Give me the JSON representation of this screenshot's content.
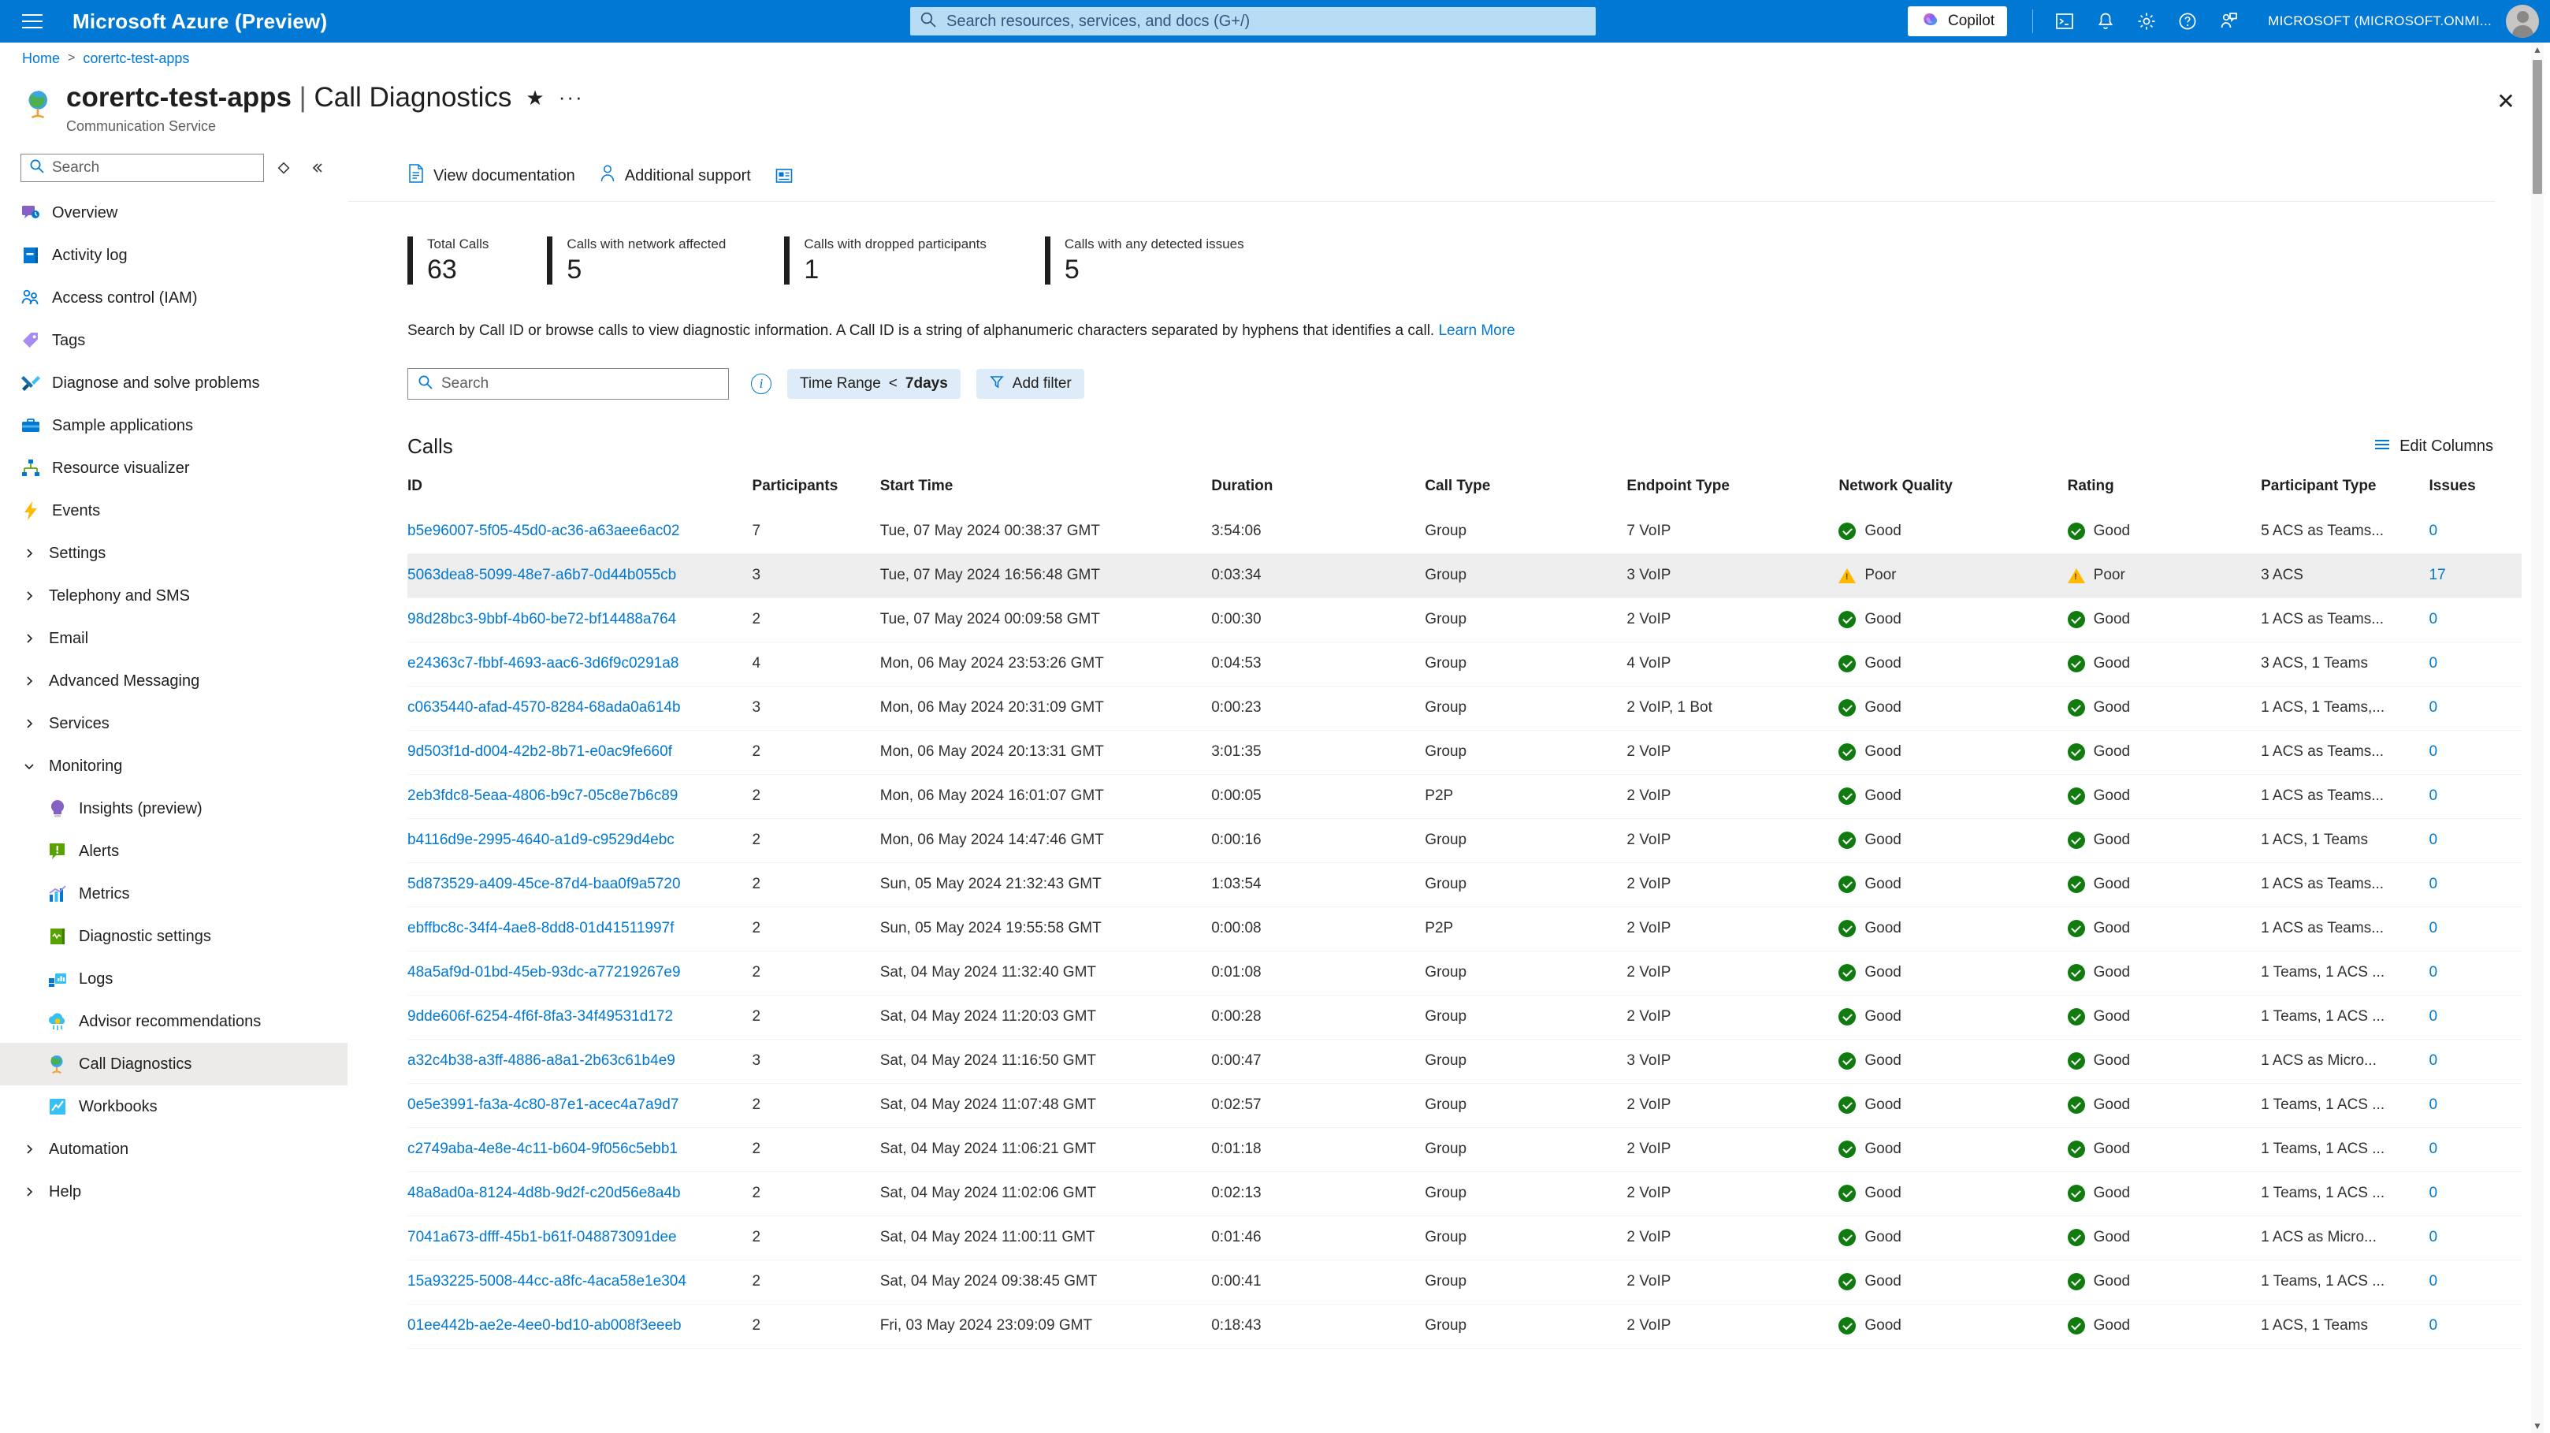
{
  "topbar": {
    "brand": "Microsoft Azure (Preview)",
    "search_placeholder": "Search resources, services, and docs (G+/)",
    "copilot_label": "Copilot",
    "tenant": "MICROSOFT (MICROSOFT.ONMI...",
    "icons": [
      "cloud-shell-icon",
      "notifications-icon",
      "settings-gear-icon",
      "help-question-icon",
      "feedback-icon"
    ]
  },
  "breadcrumb": {
    "home": "Home",
    "current": "corertc-test-apps",
    "separator": ">"
  },
  "page": {
    "resource_name": "corertc-test-apps",
    "separator": "|",
    "section": "Call Diagnostics",
    "subtitle": "Communication Service",
    "favorite_icon": "★",
    "more_icon": "···",
    "close_icon": "✕"
  },
  "sidebar": {
    "search_placeholder": "Search",
    "items": [
      {
        "label": "Overview",
        "type": "leaf",
        "icon": "overview-icon",
        "selected": false
      },
      {
        "label": "Activity log",
        "type": "leaf",
        "icon": "activity-log-icon",
        "selected": false
      },
      {
        "label": "Access control (IAM)",
        "type": "leaf",
        "icon": "access-control-icon",
        "selected": false
      },
      {
        "label": "Tags",
        "type": "leaf",
        "icon": "tags-icon",
        "selected": false
      },
      {
        "label": "Diagnose and solve problems",
        "type": "leaf",
        "icon": "diagnose-icon",
        "selected": false
      },
      {
        "label": "Sample applications",
        "type": "leaf",
        "icon": "sample-applications-icon",
        "selected": false
      },
      {
        "label": "Resource visualizer",
        "type": "leaf",
        "icon": "resource-visualizer-icon",
        "selected": false
      },
      {
        "label": "Events",
        "type": "leaf",
        "icon": "events-icon",
        "selected": false
      },
      {
        "label": "Settings",
        "type": "group",
        "expanded": false,
        "selected": false
      },
      {
        "label": "Telephony and SMS",
        "type": "group",
        "expanded": false,
        "selected": false
      },
      {
        "label": "Email",
        "type": "group",
        "expanded": false,
        "selected": false
      },
      {
        "label": "Advanced Messaging",
        "type": "group",
        "expanded": false,
        "selected": false
      },
      {
        "label": "Services",
        "type": "group",
        "expanded": false,
        "selected": false
      },
      {
        "label": "Monitoring",
        "type": "group",
        "expanded": true,
        "selected": false
      },
      {
        "label": "Insights (preview)",
        "type": "child",
        "icon": "insights-icon",
        "selected": false
      },
      {
        "label": "Alerts",
        "type": "child",
        "icon": "alerts-icon",
        "selected": false
      },
      {
        "label": "Metrics",
        "type": "child",
        "icon": "metrics-icon",
        "selected": false
      },
      {
        "label": "Diagnostic settings",
        "type": "child",
        "icon": "diagnostic-settings-icon",
        "selected": false
      },
      {
        "label": "Logs",
        "type": "child",
        "icon": "logs-icon",
        "selected": false
      },
      {
        "label": "Advisor recommendations",
        "type": "child",
        "icon": "advisor-icon",
        "selected": false
      },
      {
        "label": "Call Diagnostics",
        "type": "child",
        "icon": "call-diagnostics-icon",
        "selected": true
      },
      {
        "label": "Workbooks",
        "type": "child",
        "icon": "workbooks-icon",
        "selected": false
      },
      {
        "label": "Automation",
        "type": "group",
        "expanded": false,
        "selected": false
      },
      {
        "label": "Help",
        "type": "group",
        "expanded": false,
        "selected": false
      }
    ]
  },
  "toolbar": {
    "view_documentation": "View documentation",
    "additional_support": "Additional support",
    "extra_icon": "report-card-icon"
  },
  "stats": [
    {
      "label": "Total Calls",
      "value": "63"
    },
    {
      "label": "Calls with network affected",
      "value": "5"
    },
    {
      "label": "Calls with dropped participants",
      "value": "1"
    },
    {
      "label": "Calls with any detected issues",
      "value": "5"
    }
  ],
  "description": {
    "text": "Search by Call ID or browse calls to view diagnostic information. A Call ID is a string of alphanumeric characters separated by hyphens that identifies a call.",
    "link": "Learn More"
  },
  "filters": {
    "search_placeholder": "Search",
    "time_range_label": "Time Range",
    "time_range_operator": "<",
    "time_range_value": "7days",
    "add_filter": "Add filter"
  },
  "calls": {
    "section_title": "Calls",
    "edit_columns": "Edit Columns",
    "columns": [
      "ID",
      "Participants",
      "Start Time",
      "Duration",
      "Call Type",
      "Endpoint Type",
      "Network Quality",
      "Rating",
      "Participant Type",
      "Issues"
    ],
    "rows": [
      {
        "id": "b5e96007-5f05-45d0-ac36-a63aee6ac02",
        "participants": "7",
        "start_time": "Tue, 07 May 2024 00:38:37 GMT",
        "duration": "3:54:06",
        "call_type": "Group",
        "endpoint_type": "7 VoIP",
        "network_quality": "Good",
        "rating": "Good",
        "participant_type": "5 ACS as Teams...",
        "issues": "0",
        "highlighted": false
      },
      {
        "id": "5063dea8-5099-48e7-a6b7-0d44b055cb",
        "participants": "3",
        "start_time": "Tue, 07 May 2024 16:56:48 GMT",
        "duration": "0:03:34",
        "call_type": "Group",
        "endpoint_type": "3 VoIP",
        "network_quality": "Poor",
        "rating": "Poor",
        "participant_type": "3 ACS",
        "issues": "17",
        "highlighted": true
      },
      {
        "id": "98d28bc3-9bbf-4b60-be72-bf14488a764",
        "participants": "2",
        "start_time": "Tue, 07 May 2024 00:09:58 GMT",
        "duration": "0:00:30",
        "call_type": "Group",
        "endpoint_type": "2 VoIP",
        "network_quality": "Good",
        "rating": "Good",
        "participant_type": "1 ACS as Teams...",
        "issues": "0",
        "highlighted": false
      },
      {
        "id": "e24363c7-fbbf-4693-aac6-3d6f9c0291a8",
        "participants": "4",
        "start_time": "Mon, 06 May 2024 23:53:26 GMT",
        "duration": "0:04:53",
        "call_type": "Group",
        "endpoint_type": "4 VoIP",
        "network_quality": "Good",
        "rating": "Good",
        "participant_type": "3 ACS, 1 Teams",
        "issues": "0",
        "highlighted": false
      },
      {
        "id": "c0635440-afad-4570-8284-68ada0a614b",
        "participants": "3",
        "start_time": "Mon, 06 May 2024 20:31:09 GMT",
        "duration": "0:00:23",
        "call_type": "Group",
        "endpoint_type": "2 VoIP, 1 Bot",
        "network_quality": "Good",
        "rating": "Good",
        "participant_type": "1 ACS, 1 Teams,...",
        "issues": "0",
        "highlighted": false
      },
      {
        "id": "9d503f1d-d004-42b2-8b71-e0ac9fe660f",
        "participants": "2",
        "start_time": "Mon, 06 May 2024 20:13:31 GMT",
        "duration": "3:01:35",
        "call_type": "Group",
        "endpoint_type": "2 VoIP",
        "network_quality": "Good",
        "rating": "Good",
        "participant_type": "1 ACS as Teams...",
        "issues": "0",
        "highlighted": false
      },
      {
        "id": "2eb3fdc8-5eaa-4806-b9c7-05c8e7b6c89",
        "participants": "2",
        "start_time": "Mon, 06 May 2024 16:01:07 GMT",
        "duration": "0:00:05",
        "call_type": "P2P",
        "endpoint_type": "2 VoIP",
        "network_quality": "Good",
        "rating": "Good",
        "participant_type": "1 ACS as Teams...",
        "issues": "0",
        "highlighted": false
      },
      {
        "id": "b4116d9e-2995-4640-a1d9-c9529d4ebc",
        "participants": "2",
        "start_time": "Mon, 06 May 2024 14:47:46 GMT",
        "duration": "0:00:16",
        "call_type": "Group",
        "endpoint_type": "2 VoIP",
        "network_quality": "Good",
        "rating": "Good",
        "participant_type": "1 ACS, 1 Teams",
        "issues": "0",
        "highlighted": false
      },
      {
        "id": "5d873529-a409-45ce-87d4-baa0f9a5720",
        "participants": "2",
        "start_time": "Sun, 05 May 2024 21:32:43 GMT",
        "duration": "1:03:54",
        "call_type": "Group",
        "endpoint_type": "2 VoIP",
        "network_quality": "Good",
        "rating": "Good",
        "participant_type": "1 ACS as Teams...",
        "issues": "0",
        "highlighted": false
      },
      {
        "id": "ebffbc8c-34f4-4ae8-8dd8-01d41511997f",
        "participants": "2",
        "start_time": "Sun, 05 May 2024 19:55:58 GMT",
        "duration": "0:00:08",
        "call_type": "P2P",
        "endpoint_type": "2 VoIP",
        "network_quality": "Good",
        "rating": "Good",
        "participant_type": "1 ACS as Teams...",
        "issues": "0",
        "highlighted": false
      },
      {
        "id": "48a5af9d-01bd-45eb-93dc-a77219267e9",
        "participants": "2",
        "start_time": "Sat, 04 May 2024 11:32:40 GMT",
        "duration": "0:01:08",
        "call_type": "Group",
        "endpoint_type": "2 VoIP",
        "network_quality": "Good",
        "rating": "Good",
        "participant_type": "1 Teams, 1 ACS ...",
        "issues": "0",
        "highlighted": false
      },
      {
        "id": "9dde606f-6254-4f6f-8fa3-34f49531d172",
        "participants": "2",
        "start_time": "Sat, 04 May 2024 11:20:03 GMT",
        "duration": "0:00:28",
        "call_type": "Group",
        "endpoint_type": "2 VoIP",
        "network_quality": "Good",
        "rating": "Good",
        "participant_type": "1 Teams, 1 ACS ...",
        "issues": "0",
        "highlighted": false
      },
      {
        "id": "a32c4b38-a3ff-4886-a8a1-2b63c61b4e9",
        "participants": "3",
        "start_time": "Sat, 04 May 2024 11:16:50 GMT",
        "duration": "0:00:47",
        "call_type": "Group",
        "endpoint_type": "3 VoIP",
        "network_quality": "Good",
        "rating": "Good",
        "participant_type": "1 ACS as Micro...",
        "issues": "0",
        "highlighted": false
      },
      {
        "id": "0e5e3991-fa3a-4c80-87e1-acec4a7a9d7",
        "participants": "2",
        "start_time": "Sat, 04 May 2024 11:07:48 GMT",
        "duration": "0:02:57",
        "call_type": "Group",
        "endpoint_type": "2 VoIP",
        "network_quality": "Good",
        "rating": "Good",
        "participant_type": "1 Teams, 1 ACS ...",
        "issues": "0",
        "highlighted": false
      },
      {
        "id": "c2749aba-4e8e-4c11-b604-9f056c5ebb1",
        "participants": "2",
        "start_time": "Sat, 04 May 2024 11:06:21 GMT",
        "duration": "0:01:18",
        "call_type": "Group",
        "endpoint_type": "2 VoIP",
        "network_quality": "Good",
        "rating": "Good",
        "participant_type": "1 Teams, 1 ACS ...",
        "issues": "0",
        "highlighted": false
      },
      {
        "id": "48a8ad0a-8124-4d8b-9d2f-c20d56e8a4b",
        "participants": "2",
        "start_time": "Sat, 04 May 2024 11:02:06 GMT",
        "duration": "0:02:13",
        "call_type": "Group",
        "endpoint_type": "2 VoIP",
        "network_quality": "Good",
        "rating": "Good",
        "participant_type": "1 Teams, 1 ACS ...",
        "issues": "0",
        "highlighted": false
      },
      {
        "id": "7041a673-dfff-45b1-b61f-048873091dee",
        "participants": "2",
        "start_time": "Sat, 04 May 2024 11:00:11 GMT",
        "duration": "0:01:46",
        "call_type": "Group",
        "endpoint_type": "2 VoIP",
        "network_quality": "Good",
        "rating": "Good",
        "participant_type": "1 ACS as Micro...",
        "issues": "0",
        "highlighted": false
      },
      {
        "id": "15a93225-5008-44cc-a8fc-4aca58e1e304",
        "participants": "2",
        "start_time": "Sat, 04 May 2024 09:38:45 GMT",
        "duration": "0:00:41",
        "call_type": "Group",
        "endpoint_type": "2 VoIP",
        "network_quality": "Good",
        "rating": "Good",
        "participant_type": "1 Teams, 1 ACS ...",
        "issues": "0",
        "highlighted": false
      },
      {
        "id": "01ee442b-ae2e-4ee0-bd10-ab008f3eeeb",
        "participants": "2",
        "start_time": "Fri, 03 May 2024 23:09:09 GMT",
        "duration": "0:18:43",
        "call_type": "Group",
        "endpoint_type": "2 VoIP",
        "network_quality": "Good",
        "rating": "Good",
        "participant_type": "1 ACS, 1 Teams",
        "issues": "0",
        "highlighted": false
      }
    ]
  },
  "colors": {
    "azure_blue": "#0078d4",
    "good_green": "#107c10",
    "warn_amber": "#ffb900",
    "highlight_row": "#efeeee"
  }
}
